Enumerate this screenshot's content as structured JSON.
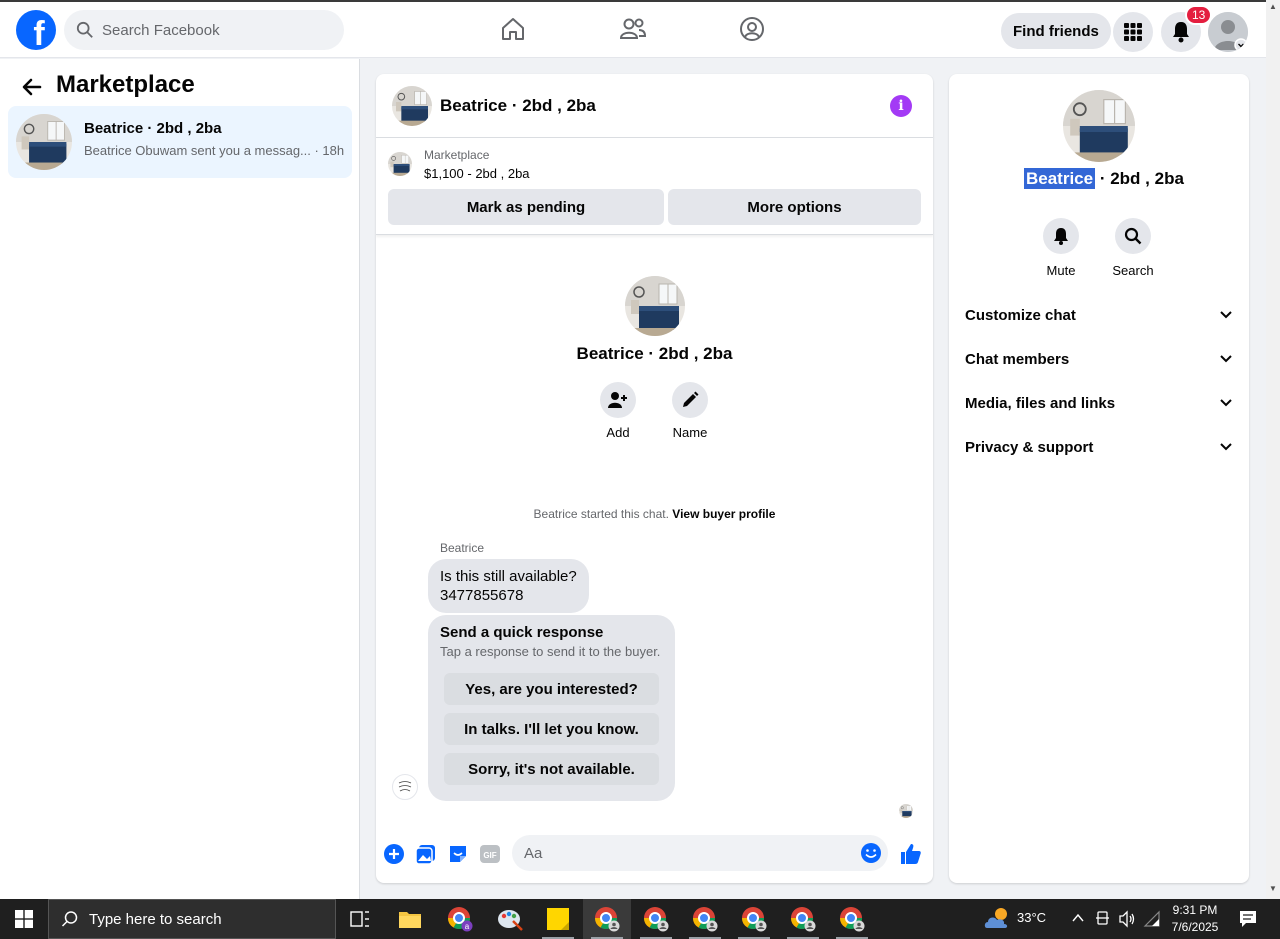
{
  "topbar": {
    "search_placeholder": "Search Facebook",
    "find_friends": "Find friends",
    "notification_count": "13",
    "brand_color": "#0866ff"
  },
  "left": {
    "title": "Marketplace",
    "conversation": {
      "name": "Beatrice · 2bd , 2ba",
      "preview": "Beatrice Obuwam sent you a messag... · 18h"
    }
  },
  "chat": {
    "title": "Beatrice · 2bd , 2ba",
    "listing": {
      "source": "Marketplace",
      "price_line": "$1,100 - 2bd , 2ba",
      "mark_pending": "Mark as pending",
      "more_options": "More options"
    },
    "profile_name": "Beatrice · 2bd , 2ba",
    "actions": {
      "add": "Add",
      "name": "Name"
    },
    "started_text": "Beatrice started this chat.",
    "view_profile": "View buyer profile",
    "sender": "Beatrice",
    "message_line1": "Is this still available?",
    "message_line2": "3477855678",
    "quick_response": {
      "title": "Send a quick response",
      "subtitle": "Tap a response to send it to the buyer.",
      "options": [
        "Yes, are you interested?",
        "In talks. I'll let you know.",
        "Sorry, it's not available."
      ]
    },
    "composer_placeholder": "Aa"
  },
  "right": {
    "name_highlight": "Beatrice",
    "name_rest": " · 2bd , 2ba",
    "mute": "Mute",
    "search": "Search",
    "sections": [
      "Customize chat",
      "Chat members",
      "Media, files and links",
      "Privacy & support"
    ]
  },
  "taskbar": {
    "search_text": "Type here to search",
    "temperature": "33°C",
    "time": "9:31 PM",
    "date": "7/6/2025"
  }
}
